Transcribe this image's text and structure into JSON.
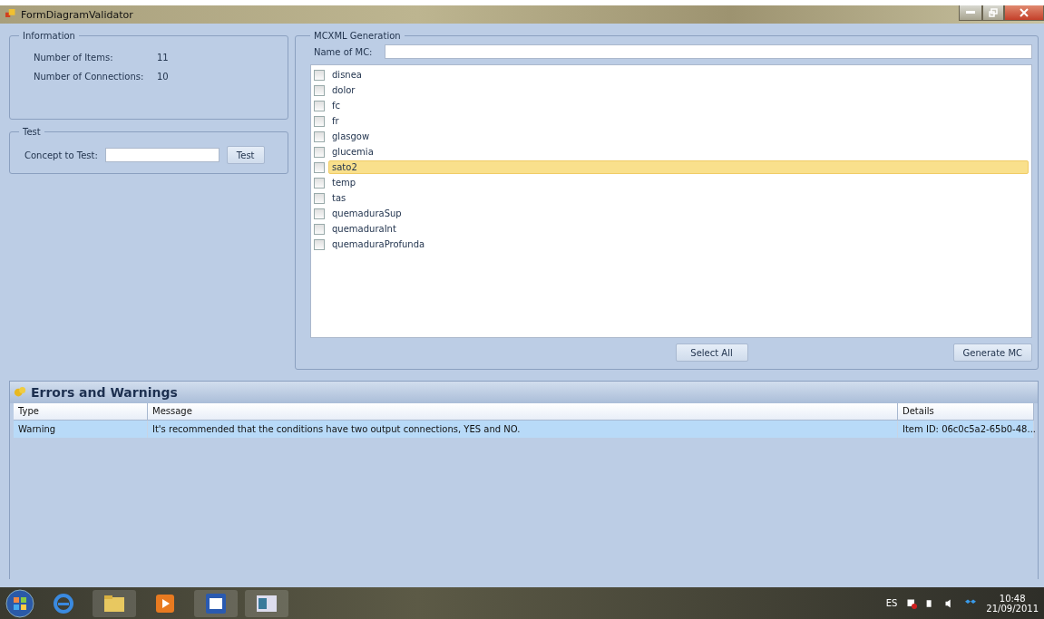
{
  "window": {
    "title": "FormDiagramValidator"
  },
  "information": {
    "title": "Information",
    "rows": [
      {
        "label": "Number of Items:",
        "value": "11"
      },
      {
        "label": "Number of Connections:",
        "value": "10"
      }
    ]
  },
  "test": {
    "title": "Test",
    "label": "Concept to Test:",
    "button": "Test"
  },
  "generation": {
    "title": "MCXML Generation",
    "name_label": "Name of MC:",
    "items": [
      {
        "label": "disnea",
        "checked": false,
        "selected": false
      },
      {
        "label": "dolor",
        "checked": false,
        "selected": false
      },
      {
        "label": "fc",
        "checked": false,
        "selected": false
      },
      {
        "label": "fr",
        "checked": false,
        "selected": false
      },
      {
        "label": "glasgow",
        "checked": false,
        "selected": false
      },
      {
        "label": "glucemia",
        "checked": false,
        "selected": false
      },
      {
        "label": "sato2",
        "checked": false,
        "selected": true
      },
      {
        "label": "temp",
        "checked": false,
        "selected": false
      },
      {
        "label": "tas",
        "checked": false,
        "selected": false
      },
      {
        "label": "quemaduraSup",
        "checked": false,
        "selected": false
      },
      {
        "label": "quemaduraInt",
        "checked": false,
        "selected": false
      },
      {
        "label": "quemaduraProfunda",
        "checked": false,
        "selected": false
      }
    ],
    "buttons": [
      "Select All",
      "Generate MC"
    ]
  },
  "errors": {
    "title": "Errors and Warnings",
    "columns": [
      "Type",
      "Message",
      "Details"
    ],
    "rows": [
      {
        "cells": [
          "Warning",
          "It's recommended that the conditions have two output connections, YES and NO.",
          "Item ID: 06c0c5a2-65b0-48..."
        ],
        "selected": true
      }
    ]
  },
  "taskbar": {
    "language": "ES",
    "time": "10:48",
    "date": "21/09/2011"
  }
}
